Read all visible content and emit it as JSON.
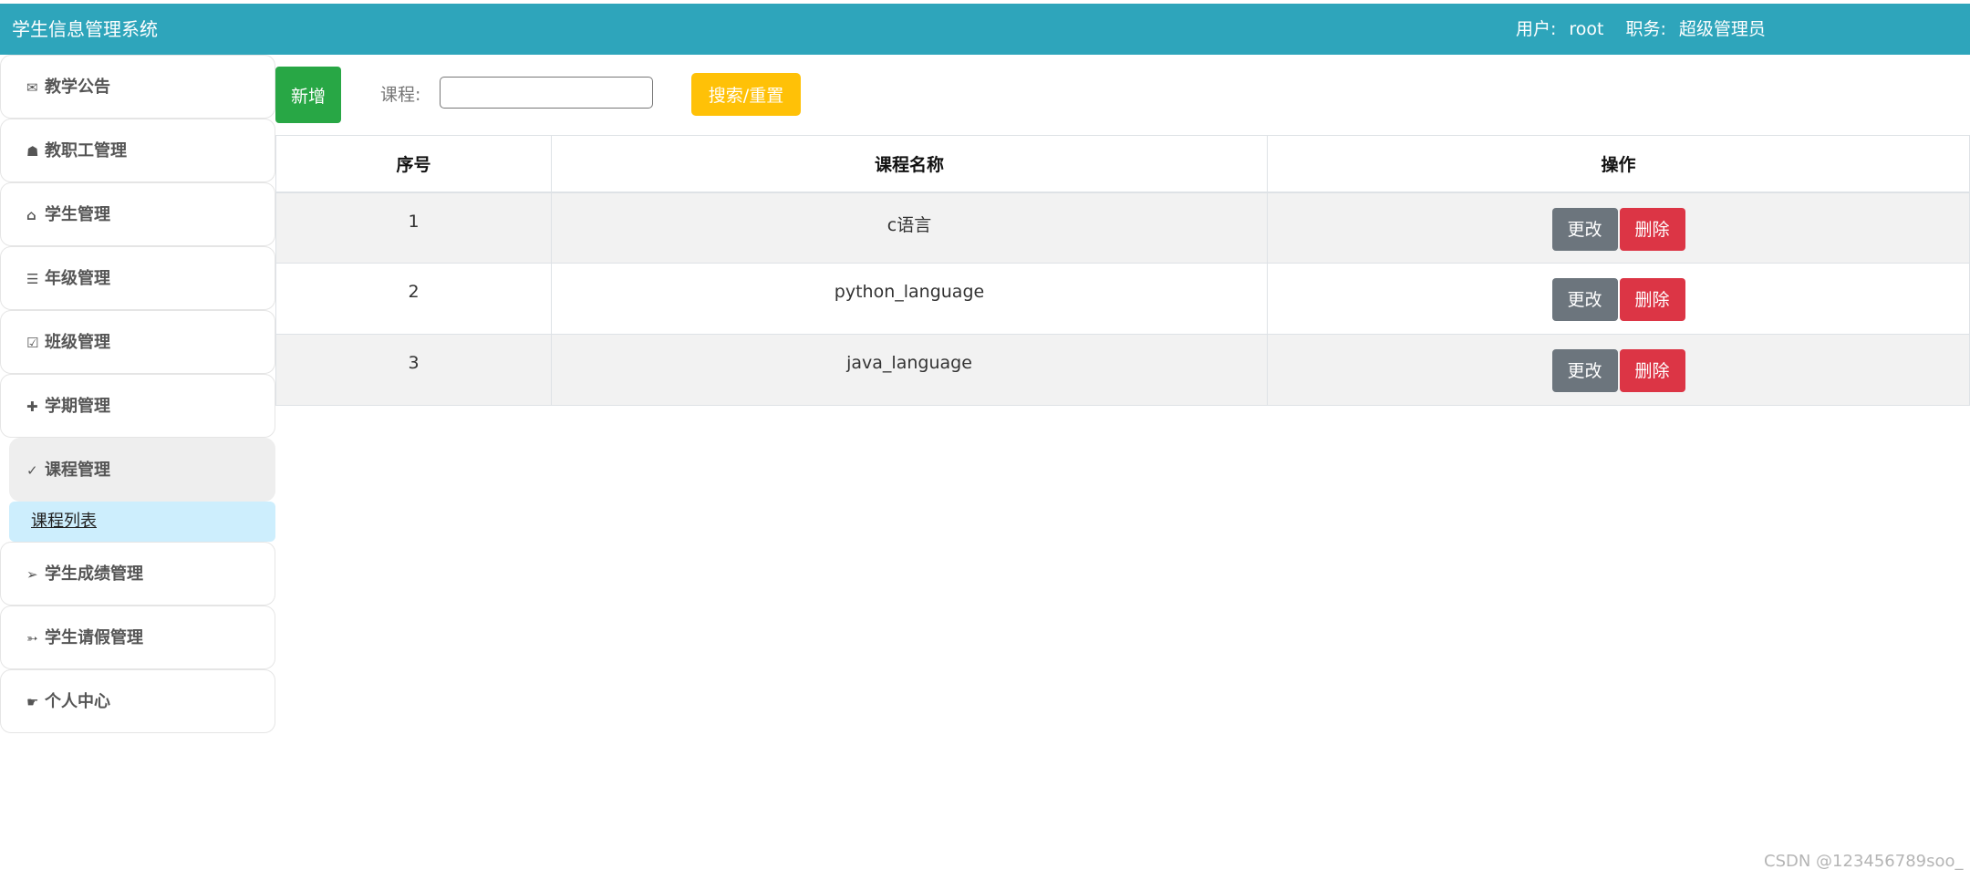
{
  "header": {
    "app_title": "学生信息管理系统",
    "user_label": "用户:",
    "user_value": "root",
    "role_label": "职务:",
    "role_value": "超级管理员",
    "bg_color": "#2ea5bb"
  },
  "sidebar": {
    "items": [
      {
        "icon": "envelope-icon",
        "glyph": "✉",
        "label": "教学公告"
      },
      {
        "icon": "bell-icon",
        "glyph": "☗",
        "label": "教职工管理"
      },
      {
        "icon": "home-icon",
        "glyph": "⌂",
        "label": "学生管理"
      },
      {
        "icon": "list-icon",
        "glyph": "☰",
        "label": "年级管理"
      },
      {
        "icon": "check-box-icon",
        "glyph": "☑",
        "label": "班级管理"
      },
      {
        "icon": "plus-icon",
        "glyph": "✚",
        "label": "学期管理"
      },
      {
        "icon": "check-icon",
        "glyph": "✓",
        "label": "课程管理"
      },
      {
        "icon": "arrow-right-icon",
        "glyph": "➢",
        "label": "学生成绩管理"
      },
      {
        "icon": "arrow-icon",
        "glyph": "➳",
        "label": "学生请假管理"
      },
      {
        "icon": "hand-point-icon",
        "glyph": "☛",
        "label": "个人中心"
      }
    ],
    "active_index": 6,
    "submenu": {
      "label": "课程列表"
    }
  },
  "toolbar": {
    "add_label": "新增",
    "search_label": "课程:",
    "search_value": "",
    "search_button_label": "搜索/重置"
  },
  "table": {
    "columns": [
      "序号",
      "课程名称",
      "操作"
    ],
    "rows": [
      {
        "id": "1",
        "name": "c语言"
      },
      {
        "id": "2",
        "name": "python_language"
      },
      {
        "id": "3",
        "name": "java_language"
      }
    ],
    "edit_label": "更改",
    "delete_label": "删除"
  },
  "watermark": "CSDN @123456789soo_"
}
